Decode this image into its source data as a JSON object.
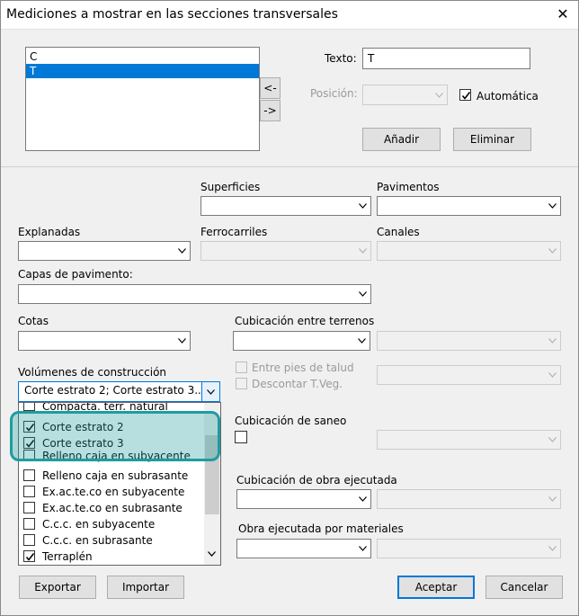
{
  "window": {
    "title": "Mediciones a mostrar en las secciones transversales"
  },
  "list": {
    "items": [
      "C",
      "T"
    ],
    "selected_index": 1
  },
  "buttons": {
    "move_left": "<-",
    "move_right": "->",
    "add": "Añadir",
    "remove": "Eliminar",
    "export": "Exportar",
    "import": "Importar",
    "accept": "Aceptar",
    "cancel": "Cancelar"
  },
  "texto": {
    "label": "Texto:",
    "value": "T"
  },
  "posicion": {
    "label": "Posición:",
    "value": ""
  },
  "automatica": {
    "label": "Automática",
    "checked": true
  },
  "labels": {
    "superficies": "Superficies",
    "pavimentos": "Pavimentos",
    "explanadas": "Explanadas",
    "ferrocarriles": "Ferrocarriles",
    "canales": "Canales",
    "capas": "Capas de pavimento:",
    "cotas": "Cotas",
    "cubicacion_terrenos": "Cubicación entre terrenos",
    "volumenes": "Volúmenes de construcción",
    "entre_pies": "Entre pies de talud",
    "descontar": "Descontar T.Veg.",
    "saneo": "Cubicación de saneo",
    "obra_ejecutada": "Cubicación de obra ejecutada",
    "obra_materiales": "Obra ejecutada por materiales"
  },
  "volumenes_combo": {
    "value": "Corte estrato 2; Corte estrato 3..."
  },
  "volumenes_list": [
    {
      "label": "Compacta. terr. natural",
      "checked": false
    },
    {
      "label": "Corte estrato 2",
      "checked": true
    },
    {
      "label": "Corte estrato 3",
      "checked": true
    },
    {
      "label": "Relleno caja en subyacente",
      "checked": false
    },
    {
      "label": "Relleno caja en subrasante",
      "checked": false
    },
    {
      "label": "Ex.ac.te.co en subyacente",
      "checked": false
    },
    {
      "label": "Ex.ac.te.co en subrasante",
      "checked": false
    },
    {
      "label": "C.c.c. en subyacente",
      "checked": false
    },
    {
      "label": "C.c.c. en subrasante",
      "checked": false
    },
    {
      "label": "Terraplén",
      "checked": true
    }
  ],
  "icons": {
    "close": "close-icon",
    "dropdown": "chevron-down-icon",
    "check": "check-icon"
  },
  "colors": {
    "selection": "#0078d7",
    "highlight": "#1e9ca0"
  }
}
